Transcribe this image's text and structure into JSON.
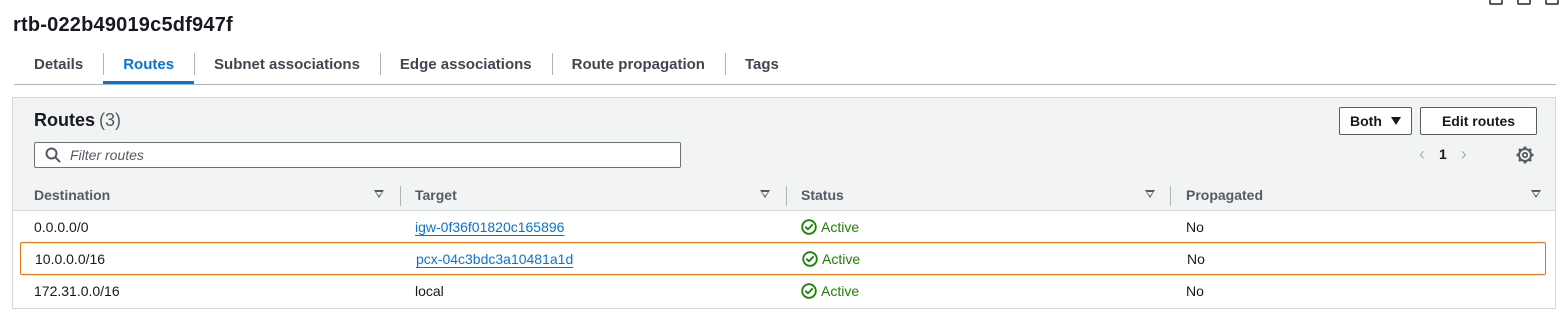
{
  "page": {
    "title": "rtb-022b49019c5df947f"
  },
  "tabs": [
    {
      "label": "Details",
      "active": false
    },
    {
      "label": "Routes",
      "active": true
    },
    {
      "label": "Subnet associations",
      "active": false
    },
    {
      "label": "Edge associations",
      "active": false
    },
    {
      "label": "Route propagation",
      "active": false
    },
    {
      "label": "Tags",
      "active": false
    }
  ],
  "routes_panel": {
    "title": "Routes",
    "count": "(3)",
    "filter_placeholder": "Filter routes",
    "filter_value": "",
    "view_select": "Both",
    "edit_button": "Edit routes",
    "page_number": "1"
  },
  "columns": {
    "destination": "Destination",
    "target": "Target",
    "status": "Status",
    "propagated": "Propagated"
  },
  "rows": [
    {
      "destination": "0.0.0.0/0",
      "target": "igw-0f36f01820c165896",
      "target_is_link": true,
      "status": "Active",
      "propagated": "No",
      "highlighted": false
    },
    {
      "destination": "10.0.0.0/16",
      "target": "pcx-04c3bdc3a10481a1d",
      "target_is_link": true,
      "status": "Active",
      "propagated": "No",
      "highlighted": true
    },
    {
      "destination": "172.31.0.0/16",
      "target": "local",
      "target_is_link": false,
      "status": "Active",
      "propagated": "No",
      "highlighted": false
    }
  ],
  "icons": {
    "filter": "search-icon",
    "status": "check-circle-icon",
    "sort": "caret-down-icon",
    "settings": "gear-icon",
    "pager_prev": "chevron-left-icon",
    "pager_next": "chevron-right-icon",
    "select": "caret-down-icon"
  },
  "colors": {
    "link": "#0972d3",
    "active_tab": "#0972d3",
    "status_active": "#1d8102",
    "highlight_border": "#ec7211",
    "header_bg": "#f2f3f3"
  }
}
